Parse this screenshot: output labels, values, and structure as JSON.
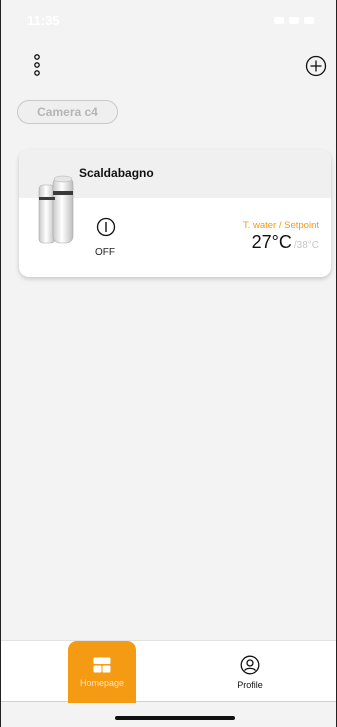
{
  "status_bar": {
    "time": "11:35"
  },
  "header": {
    "menu_icon": "vertical-dots-icon",
    "add_icon": "circle-plus-icon"
  },
  "room_chip": {
    "label": "Camera c4"
  },
  "device_card": {
    "name": "Scaldabagno",
    "power_state": "OFF",
    "temp_caption": "T. water / Setpoint",
    "temp_current": "27°C",
    "temp_setpoint": "/38°C",
    "accent_color": "#f59a13"
  },
  "tab_bar": {
    "tabs": [
      {
        "label": "Homepage",
        "icon": "home-grid-icon",
        "active": true
      },
      {
        "label": "Profile",
        "icon": "user-circle-icon",
        "active": false
      }
    ]
  }
}
